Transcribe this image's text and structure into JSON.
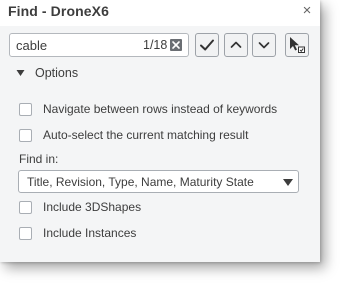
{
  "dialog": {
    "title": "Find - DroneX6",
    "close_glyph": "×"
  },
  "search": {
    "value": "cable",
    "placeholder": "",
    "counter": "1/18"
  },
  "toolbar": {
    "confirm_icon": "checkmark-icon",
    "up_icon": "chevron-up-icon",
    "down_icon": "chevron-down-icon",
    "select_icon": "select-in-tree-icon"
  },
  "options": {
    "label": "Options",
    "expanded": true,
    "checkboxes": [
      {
        "label": "Navigate between rows instead of keywords",
        "checked": false
      },
      {
        "label": "Auto-select the current matching result",
        "checked": false
      },
      {
        "label": "Include 3DShapes",
        "checked": false
      },
      {
        "label": "Include Instances",
        "checked": false
      }
    ],
    "find_in": {
      "label": "Find in:",
      "selected": "Title, Revision, Type, Name, Maturity State"
    }
  },
  "colors": {
    "panel_bg": "#f4f5f6",
    "text": "#3d3d3d",
    "border": "#a9aeb4"
  }
}
